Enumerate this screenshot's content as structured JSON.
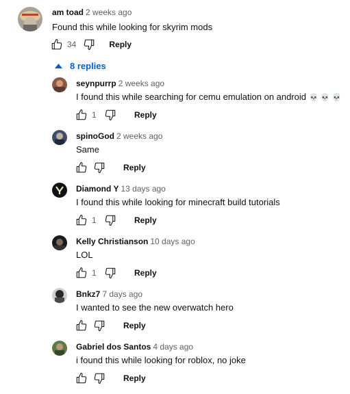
{
  "top_comment": {
    "author": "am toad",
    "time": "2 weeks ago",
    "text": "Found this while looking for skyrim mods",
    "likes": "34",
    "reply_label": "Reply"
  },
  "replies_toggle": {
    "label": "8 replies"
  },
  "replies": [
    {
      "author": "seynpurrp",
      "time": "2 weeks ago",
      "text": "I found this while searching for cemu emulation on android",
      "emoji": "💀 💀 💀",
      "likes": "1",
      "reply_label": "Reply"
    },
    {
      "author": "spinoGod",
      "time": "2 weeks ago",
      "text": "Same",
      "likes": "",
      "reply_label": "Reply"
    },
    {
      "author": "Diamond Y",
      "time": "13 days ago",
      "text": "I found this while looking for minecraft build tutorials",
      "likes": "1",
      "reply_label": "Reply"
    },
    {
      "author": "Kelly Christianson",
      "time": "10 days ago",
      "text": "LOL",
      "likes": "1",
      "reply_label": "Reply"
    },
    {
      "author": "Bnkz7",
      "time": "7 days ago",
      "text": "I wanted to see the new overwatch hero",
      "likes": "",
      "reply_label": "Reply"
    },
    {
      "author": "Gabriel dos Santos",
      "time": "4 days ago",
      "text": "i found this while looking for roblox, no joke",
      "likes": "",
      "reply_label": "Reply"
    }
  ],
  "colors": {
    "link_blue": "#065fd4",
    "meta_gray": "#606060",
    "text": "#0f0f0f"
  }
}
